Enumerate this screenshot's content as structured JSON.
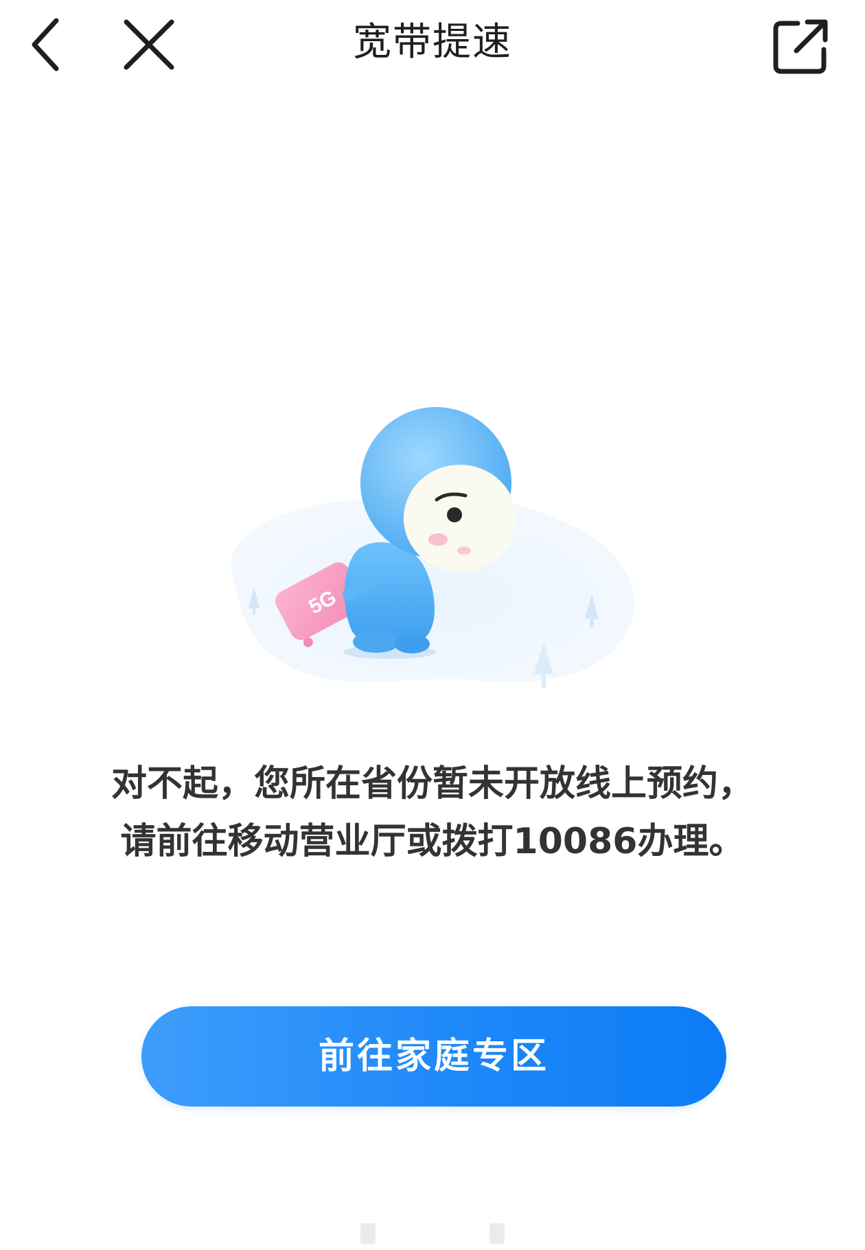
{
  "nav": {
    "title": "宽带提速",
    "back_icon": "chevron-left-icon",
    "close_icon": "close-icon",
    "share_icon": "external-link-icon"
  },
  "illustration": {
    "suitcase_text": "5G",
    "colors": {
      "character": "#5fb8f7",
      "face": "#fbfaf0",
      "suitcase": "#f79ac0",
      "ground": "#e8f3fd"
    }
  },
  "message": {
    "line1": "对不起，您所在省份暂未开放线上预约，",
    "line2": "请前往移动营业厅或拨打10086办理。"
  },
  "cta": {
    "label": "前往家庭专区",
    "color": "#1b86f8"
  }
}
